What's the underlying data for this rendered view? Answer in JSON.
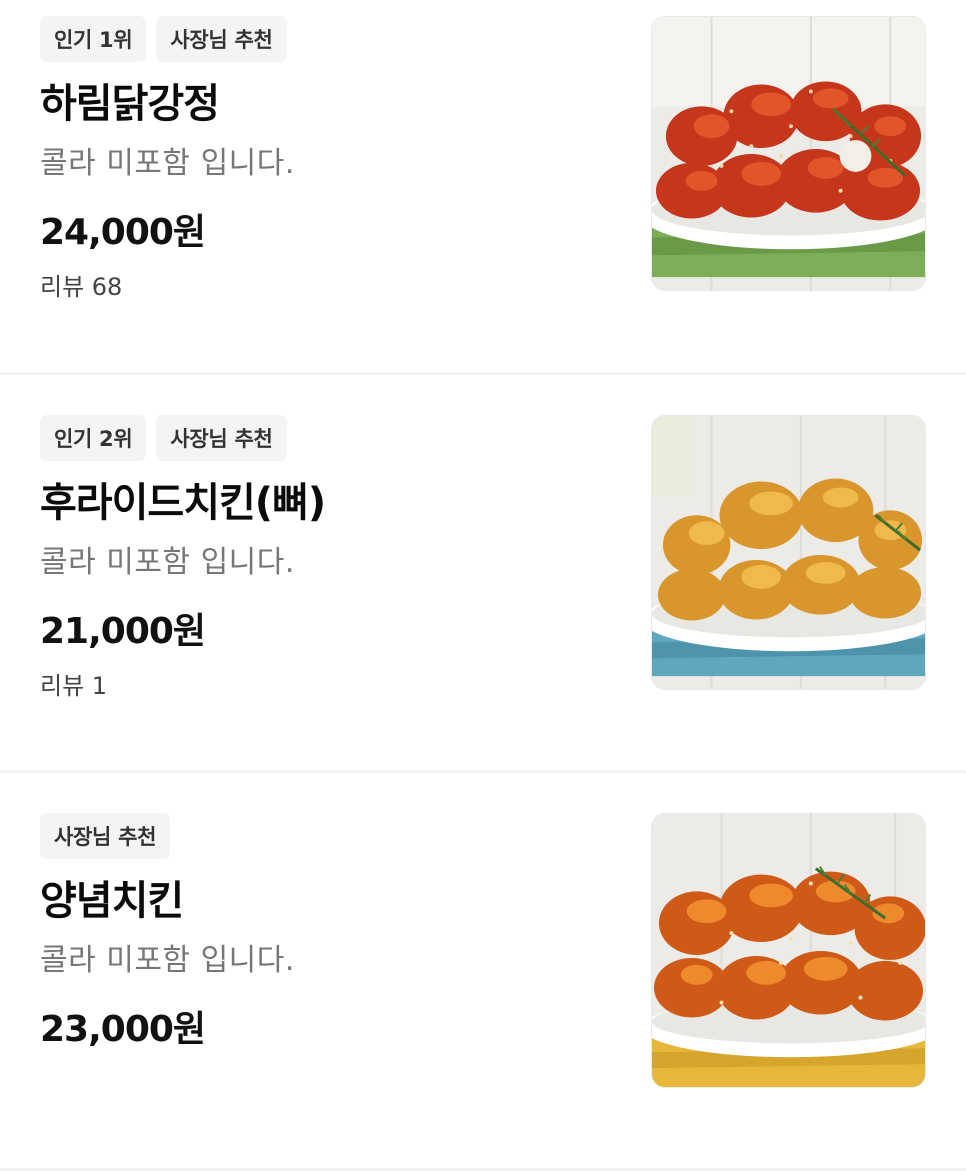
{
  "menu": {
    "items": [
      {
        "badges": [
          "인기 1위",
          "사장님 추천"
        ],
        "name": "하림닭강정",
        "description": "콜라 미포함 입니다.",
        "price": "24,000원",
        "review": "리뷰 68",
        "image": "gangjeong-chicken-photo",
        "colors": {
          "cloth": "#7cae57",
          "sauce": "#c5361b",
          "sauce_light": "#e2552a"
        }
      },
      {
        "badges": [
          "인기 2위",
          "사장님 추천"
        ],
        "name": "후라이드치킨(뼈)",
        "description": "콜라 미포함 입니다.",
        "price": "21,000원",
        "review": "리뷰 1",
        "image": "fried-chicken-photo",
        "colors": {
          "cloth": "#5fa7bf",
          "sauce": "#d9962c",
          "sauce_light": "#f0b94b"
        }
      },
      {
        "badges": [
          "사장님 추천"
        ],
        "name": "양념치킨",
        "description": "콜라 미포함 입니다.",
        "price": "23,000원",
        "image": "yangnyeom-chicken-photo",
        "colors": {
          "cloth": "#e7b73b",
          "sauce": "#cf5a17",
          "sauce_light": "#ee8a2c"
        }
      }
    ]
  }
}
